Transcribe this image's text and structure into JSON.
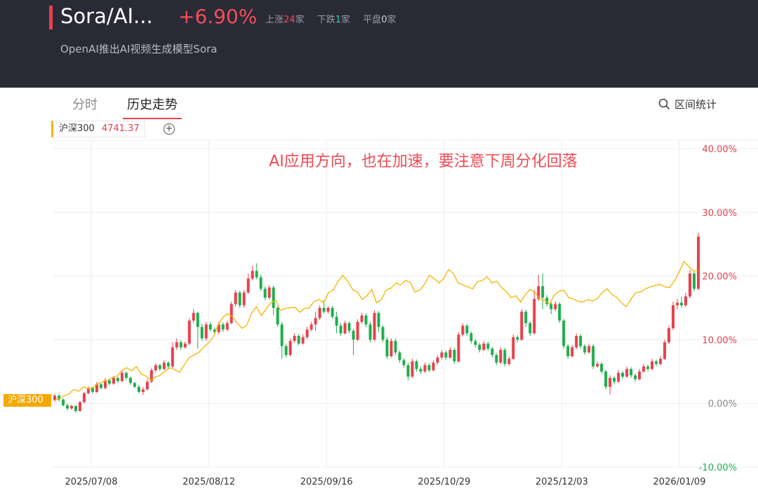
{
  "header": {
    "title": "Sora/AI...",
    "change": "+6.90%",
    "up_label": "上涨",
    "up_count": "24",
    "down_label": "下跌",
    "down_count": "1",
    "flat_label": "平盘",
    "flat_count": "0",
    "unit": "家",
    "subtitle": "OpenAI推出AI视频生成模型Sora"
  },
  "tabs": [
    {
      "label": "分时",
      "active": false
    },
    {
      "label": "历史走势",
      "active": true
    }
  ],
  "range_button": "区间统计",
  "legend": {
    "name": "沪深300",
    "value": "4741.37",
    "color": "#f5b400"
  },
  "series_tag": "沪深300",
  "colors": {
    "up": "#e8414b",
    "down": "#1fae4e",
    "line": "#f5b400",
    "header_bg": "#2a2a36"
  },
  "chart_data": {
    "type": "line",
    "annotation": "AI应用方向，也在加速，要注意下周分化回落",
    "y_ticks": [
      "40.00%",
      "30.00%",
      "20.00%",
      "10.00%",
      "0.00%",
      "-10.00%"
    ],
    "y_tick_values": [
      40,
      30,
      20,
      10,
      0,
      -10
    ],
    "ylim": [
      -10,
      40
    ],
    "x_ticks": [
      "2025/07/08",
      "2025/08/12",
      "2025/09/16",
      "2025/10/29",
      "2025/12/03",
      "2026/01/09"
    ],
    "grid": true,
    "series": [
      {
        "name": "沪深300",
        "values": [
          0.5,
          0.8,
          1.2,
          1.5,
          2.2,
          1.9,
          2.6,
          2.3,
          2.5,
          3.1,
          3.4,
          3.6,
          4.1,
          4.3,
          5.2,
          5.6,
          5.1,
          5.8,
          4.6,
          4.3,
          3.6,
          4.2,
          4.4,
          5.1,
          5.6,
          5.3,
          4.9,
          6.1,
          7.2,
          7.6,
          8.0,
          8.8,
          9.5,
          10.4,
          12.3,
          13.5,
          14.1,
          13.6,
          12.6,
          11.8,
          12.3,
          14.2,
          15.2,
          13.8,
          14.8,
          15.8,
          16.2,
          14.6,
          14.9,
          15.0,
          15.1,
          14.3,
          14.9,
          15.0,
          16.0,
          16.3,
          15.8,
          17.4,
          17.8,
          19.2,
          20.1,
          19.2,
          17.9,
          17.5,
          16.3,
          16.9,
          17.9,
          15.8,
          16.3,
          17.8,
          18.1,
          18.9,
          18.6,
          19.3,
          19.0,
          17.5,
          17.8,
          18.7,
          20.1,
          19.6,
          18.9,
          19.6,
          21.0,
          20.4,
          18.9,
          18.6,
          18.3,
          18.0,
          19.1,
          19.3,
          19.9,
          18.9,
          19.2,
          18.2,
          17.6,
          16.6,
          16.9,
          15.9,
          17.1,
          17.9,
          17.4,
          16.4,
          16.2,
          15.6,
          17.0,
          17.6,
          17.8,
          16.6,
          16.4,
          16.0,
          15.9,
          16.3,
          16.1,
          16.5,
          17.4,
          18.0,
          17.1,
          16.7,
          15.8,
          15.2,
          16.4,
          17.4,
          17.5,
          18.0,
          18.3,
          18.5,
          18.7,
          18.3,
          18.2,
          19.2,
          20.6,
          22.3,
          21.5,
          20.8,
          20.9
        ]
      }
    ],
    "candles": [
      [
        0.5,
        1.2,
        1.5,
        0.2
      ],
      [
        1.2,
        0.6,
        1.5,
        0.3
      ],
      [
        0.6,
        -0.3,
        0.8,
        -0.5
      ],
      [
        -0.3,
        -0.8,
        0.0,
        -1.1
      ],
      [
        -0.8,
        -0.4,
        -0.2,
        -1.0
      ],
      [
        -0.4,
        -1.2,
        -0.3,
        -1.5
      ],
      [
        -1.2,
        0.2,
        0.4,
        -1.3
      ],
      [
        0.2,
        1.6,
        1.8,
        0.0
      ],
      [
        1.6,
        2.4,
        2.7,
        1.4
      ],
      [
        2.4,
        1.8,
        2.6,
        1.5
      ],
      [
        1.8,
        3.0,
        3.4,
        1.6
      ],
      [
        3.0,
        2.4,
        3.2,
        2.2
      ],
      [
        2.4,
        3.6,
        4.0,
        2.2
      ],
      [
        3.6,
        3.1,
        3.8,
        2.8
      ],
      [
        3.1,
        4.0,
        4.3,
        2.9
      ],
      [
        4.0,
        3.5,
        4.2,
        3.2
      ],
      [
        3.5,
        4.8,
        5.2,
        3.3
      ],
      [
        4.8,
        4.0,
        5.0,
        3.7
      ],
      [
        4.0,
        3.2,
        4.2,
        2.9
      ],
      [
        3.2,
        2.6,
        3.4,
        2.4
      ],
      [
        2.6,
        1.8,
        2.9,
        1.6
      ],
      [
        1.8,
        2.2,
        2.6,
        1.3
      ],
      [
        2.2,
        3.4,
        3.8,
        2.0
      ],
      [
        3.4,
        5.2,
        5.6,
        3.2
      ],
      [
        5.2,
        6.0,
        6.3,
        4.9
      ],
      [
        6.0,
        5.4,
        6.2,
        5.1
      ],
      [
        5.4,
        6.4,
        6.8,
        5.2
      ],
      [
        6.4,
        5.8,
        6.6,
        5.4
      ],
      [
        5.8,
        8.8,
        9.6,
        5.6
      ],
      [
        8.8,
        9.6,
        10.2,
        8.4
      ],
      [
        9.6,
        8.8,
        9.9,
        8.4
      ],
      [
        8.8,
        9.4,
        9.7,
        8.6
      ],
      [
        9.4,
        13.0,
        13.4,
        9.1
      ],
      [
        13.0,
        14.2,
        14.8,
        12.6
      ],
      [
        14.2,
        12.0,
        14.4,
        8.6
      ],
      [
        12.0,
        10.2,
        12.5,
        9.8
      ],
      [
        10.2,
        12.4,
        12.8,
        9.8
      ],
      [
        12.4,
        11.6,
        12.8,
        11.3
      ],
      [
        11.6,
        11.2,
        11.9,
        10.8
      ],
      [
        11.2,
        12.4,
        12.8,
        10.8
      ],
      [
        12.4,
        11.6,
        12.7,
        11.2
      ],
      [
        11.6,
        12.6,
        13.0,
        11.3
      ],
      [
        12.6,
        15.6,
        16.0,
        12.4
      ],
      [
        15.6,
        17.4,
        17.8,
        15.2
      ],
      [
        17.4,
        15.4,
        17.7,
        15.0
      ],
      [
        15.4,
        17.4,
        17.8,
        15.0
      ],
      [
        17.4,
        19.6,
        20.4,
        17.2
      ],
      [
        19.6,
        20.8,
        21.6,
        19.3
      ],
      [
        20.8,
        19.8,
        22.0,
        19.5
      ],
      [
        19.8,
        18.0,
        20.2,
        17.6
      ],
      [
        18.0,
        16.6,
        18.4,
        16.2
      ],
      [
        16.6,
        18.2,
        18.6,
        16.3
      ],
      [
        18.2,
        15.0,
        18.5,
        13.8
      ],
      [
        15.0,
        12.4,
        15.3,
        12.0
      ],
      [
        12.4,
        9.0,
        12.8,
        7.0
      ],
      [
        9.0,
        7.6,
        9.4,
        7.2
      ],
      [
        7.6,
        9.8,
        10.2,
        7.4
      ],
      [
        9.8,
        10.6,
        11.0,
        9.5
      ],
      [
        10.6,
        9.4,
        10.9,
        9.1
      ],
      [
        9.4,
        10.4,
        10.8,
        9.2
      ],
      [
        10.4,
        11.6,
        12.0,
        10.1
      ],
      [
        11.6,
        12.4,
        12.8,
        11.3
      ],
      [
        12.4,
        13.4,
        14.4,
        11.4
      ],
      [
        13.4,
        15.0,
        15.4,
        13.1
      ],
      [
        15.0,
        14.4,
        16.2,
        14.1
      ],
      [
        14.4,
        15.0,
        15.3,
        14.1
      ],
      [
        15.0,
        13.6,
        15.3,
        13.3
      ],
      [
        13.6,
        12.2,
        14.4,
        11.0
      ],
      [
        12.2,
        11.0,
        12.6,
        10.6
      ],
      [
        11.0,
        12.6,
        13.0,
        10.8
      ],
      [
        12.6,
        11.4,
        12.9,
        11.0
      ],
      [
        11.4,
        10.0,
        11.7,
        7.6
      ],
      [
        10.0,
        12.8,
        13.2,
        9.8
      ],
      [
        12.8,
        13.8,
        14.2,
        12.5
      ],
      [
        13.8,
        12.4,
        14.1,
        12.0
      ],
      [
        12.4,
        10.0,
        12.8,
        9.6
      ],
      [
        10.0,
        14.2,
        14.6,
        9.8
      ],
      [
        14.2,
        12.0,
        14.5,
        11.2
      ],
      [
        12.0,
        10.0,
        12.3,
        9.6
      ],
      [
        10.0,
        7.4,
        10.4,
        7.0
      ],
      [
        7.4,
        9.8,
        10.2,
        7.2
      ],
      [
        9.8,
        8.0,
        10.2,
        7.6
      ],
      [
        8.0,
        6.8,
        8.3,
        6.4
      ],
      [
        6.8,
        6.0,
        7.1,
        5.6
      ],
      [
        6.0,
        4.2,
        6.4,
        3.6
      ],
      [
        4.2,
        6.6,
        7.0,
        4.0
      ],
      [
        6.6,
        5.4,
        6.9,
        5.0
      ],
      [
        5.4,
        5.0,
        5.8,
        4.6
      ],
      [
        5.0,
        6.0,
        6.4,
        4.8
      ],
      [
        6.0,
        5.2,
        6.3,
        4.9
      ],
      [
        5.2,
        6.4,
        6.8,
        5.0
      ],
      [
        6.4,
        7.2,
        7.6,
        6.1
      ],
      [
        7.2,
        8.0,
        8.4,
        6.9
      ],
      [
        8.0,
        7.2,
        8.3,
        6.8
      ],
      [
        7.2,
        8.4,
        8.8,
        7.0
      ],
      [
        8.4,
        6.6,
        8.7,
        6.2
      ],
      [
        6.6,
        10.8,
        11.2,
        6.4
      ],
      [
        10.8,
        12.2,
        12.6,
        10.5
      ],
      [
        12.2,
        11.0,
        12.5,
        10.6
      ],
      [
        11.0,
        9.8,
        11.3,
        9.4
      ],
      [
        9.8,
        9.2,
        10.1,
        8.8
      ],
      [
        9.2,
        8.4,
        9.5,
        8.0
      ],
      [
        8.4,
        9.4,
        9.8,
        8.2
      ],
      [
        9.4,
        8.6,
        9.7,
        8.3
      ],
      [
        8.6,
        7.6,
        8.9,
        7.2
      ],
      [
        7.6,
        6.4,
        7.9,
        6.0
      ],
      [
        6.4,
        8.4,
        8.8,
        6.2
      ],
      [
        8.4,
        6.2,
        8.7,
        5.8
      ],
      [
        6.2,
        7.0,
        7.4,
        5.9
      ],
      [
        7.0,
        10.4,
        10.8,
        6.8
      ],
      [
        10.4,
        10.0,
        10.7,
        9.6
      ],
      [
        10.0,
        14.4,
        14.8,
        9.8
      ],
      [
        14.4,
        12.6,
        14.7,
        12.0
      ],
      [
        12.6,
        11.0,
        12.9,
        10.6
      ],
      [
        11.0,
        16.4,
        17.8,
        10.8
      ],
      [
        16.4,
        18.4,
        20.2,
        16.1
      ],
      [
        18.4,
        16.6,
        20.4,
        14.8
      ],
      [
        16.6,
        15.6,
        17.0,
        15.2
      ],
      [
        15.6,
        14.8,
        15.9,
        14.0
      ],
      [
        14.8,
        15.6,
        16.0,
        14.5
      ],
      [
        15.6,
        13.0,
        15.9,
        12.6
      ],
      [
        13.0,
        9.0,
        13.3,
        8.6
      ],
      [
        9.0,
        7.4,
        9.3,
        7.0
      ],
      [
        7.4,
        8.8,
        9.2,
        7.2
      ],
      [
        8.8,
        10.6,
        11.0,
        8.5
      ],
      [
        10.6,
        9.0,
        10.9,
        8.6
      ],
      [
        9.0,
        8.0,
        9.3,
        7.6
      ],
      [
        8.0,
        9.0,
        9.4,
        7.8
      ],
      [
        9.0,
        5.8,
        9.3,
        5.4
      ],
      [
        5.8,
        6.2,
        6.6,
        5.6
      ],
      [
        6.2,
        5.0,
        6.5,
        4.6
      ],
      [
        5.0,
        2.6,
        5.3,
        2.2
      ],
      [
        2.6,
        4.0,
        4.4,
        1.4
      ],
      [
        4.0,
        3.4,
        4.3,
        3.0
      ],
      [
        3.4,
        4.8,
        5.2,
        3.2
      ],
      [
        4.8,
        4.2,
        5.1,
        3.8
      ],
      [
        4.2,
        5.4,
        5.8,
        4.0
      ],
      [
        5.4,
        4.4,
        5.7,
        4.0
      ],
      [
        4.4,
        3.8,
        4.7,
        3.4
      ],
      [
        3.8,
        5.0,
        5.4,
        3.6
      ],
      [
        5.0,
        5.8,
        6.2,
        4.8
      ],
      [
        5.8,
        5.4,
        6.1,
        5.0
      ],
      [
        5.4,
        6.6,
        7.0,
        5.2
      ],
      [
        6.6,
        6.2,
        6.9,
        5.8
      ],
      [
        6.2,
        7.0,
        7.4,
        6.0
      ],
      [
        7.0,
        9.6,
        10.0,
        6.8
      ],
      [
        9.6,
        11.8,
        12.2,
        9.3
      ],
      [
        11.8,
        15.4,
        16.0,
        11.5
      ],
      [
        15.4,
        15.8,
        16.4,
        14.8
      ],
      [
        15.8,
        15.4,
        16.8,
        15.0
      ],
      [
        15.4,
        16.8,
        17.4,
        15.2
      ],
      [
        16.8,
        20.4,
        21.0,
        16.5
      ],
      [
        20.4,
        18.0,
        20.7,
        17.6
      ],
      [
        18.0,
        26.2,
        26.8,
        17.8
      ]
    ]
  }
}
